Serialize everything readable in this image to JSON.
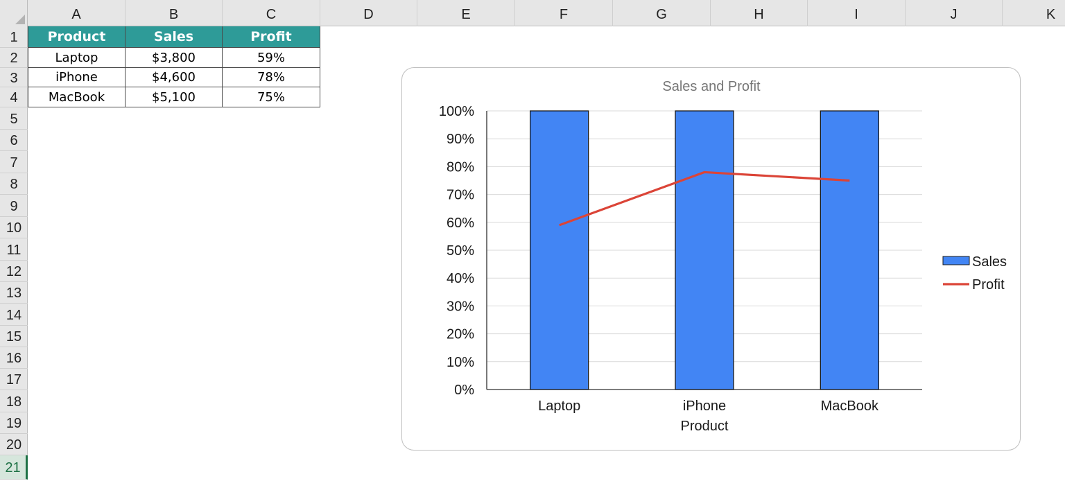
{
  "columns": [
    "A",
    "B",
    "C",
    "D",
    "E",
    "F",
    "G",
    "H",
    "I",
    "J",
    "K"
  ],
  "rows": [
    "1",
    "2",
    "3",
    "4",
    "5",
    "6",
    "7",
    "8",
    "9",
    "10",
    "11",
    "12",
    "13",
    "14",
    "15",
    "16",
    "17",
    "18",
    "19",
    "20",
    "21"
  ],
  "active_row": "21",
  "table": {
    "headers": [
      "Product",
      "Sales",
      "Profit"
    ],
    "rows": [
      [
        "Laptop",
        "$3,800",
        "59%"
      ],
      [
        "iPhone",
        "$4,600",
        "78%"
      ],
      [
        "MacBook",
        "$5,100",
        "75%"
      ]
    ]
  },
  "colors": {
    "header_fill": "#2e9b98",
    "bar_fill": "#4285f4",
    "line": "#db4437"
  },
  "chart_data": {
    "type": "bar",
    "title": "Sales and Profit",
    "xlabel": "Product",
    "ylabel": "",
    "categories": [
      "Laptop",
      "iPhone",
      "MacBook"
    ],
    "series": [
      {
        "name": "Sales",
        "type": "bar",
        "values": [
          3800,
          4600,
          5100
        ],
        "display": "clipped at 100%"
      },
      {
        "name": "Profit",
        "type": "line",
        "values": [
          0.59,
          0.78,
          0.75
        ]
      }
    ],
    "y_ticks": [
      "0%",
      "10%",
      "20%",
      "30%",
      "40%",
      "50%",
      "60%",
      "70%",
      "80%",
      "90%",
      "100%"
    ],
    "ylim": [
      0,
      1
    ],
    "grid": true,
    "legend_position": "right"
  }
}
